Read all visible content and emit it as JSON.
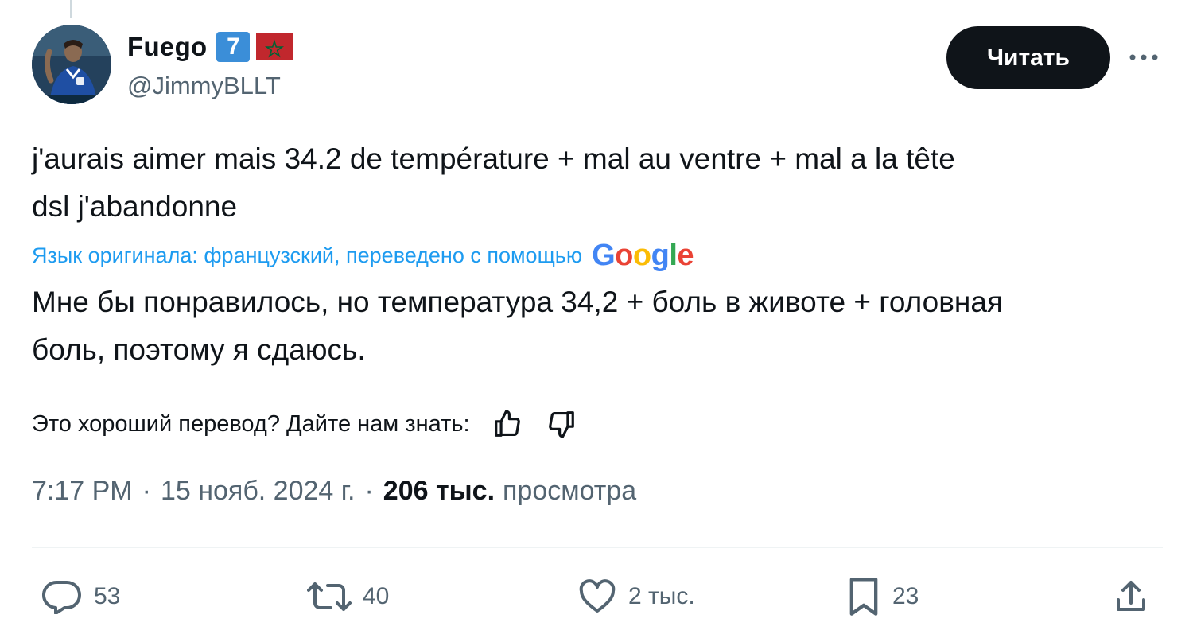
{
  "tweet": {
    "author": {
      "display_name": "Fuego",
      "badge": "7",
      "flag": "morocco-flag",
      "handle": "@JimmyBLLT"
    },
    "follow_label": "Читать",
    "text": "j'aurais aimer mais 34.2 de température + mal au ventre + mal a la tête\ndsl j'abandonne",
    "translation_note": "Язык оригинала: французский, переведено с помощью",
    "translation_provider": "Google",
    "translation": "Мне бы понравилось, но температура 34,2 + боль в животе + головная\nболь, поэтому я сдаюсь.",
    "feedback_question": "Это хороший перевод? Дайте нам знать:",
    "time": "7:17 PM",
    "date": "15 нояб. 2024 г.",
    "views_count": "206 тыс.",
    "views_label": "просмотра"
  },
  "actions": {
    "replies": "53",
    "retweets": "40",
    "likes": "2 тыс.",
    "bookmarks": "23"
  },
  "colors": {
    "text": "#0f1419",
    "secondary": "#536471",
    "link": "#1d9bf0",
    "badge": "#3b8ed8",
    "flag_red": "#c1272d",
    "flag_green": "#006233"
  },
  "icons": [
    "more-icon",
    "thumbs-up-icon",
    "thumbs-down-icon",
    "reply-icon",
    "retweet-icon",
    "like-icon",
    "bookmark-icon",
    "share-icon"
  ]
}
